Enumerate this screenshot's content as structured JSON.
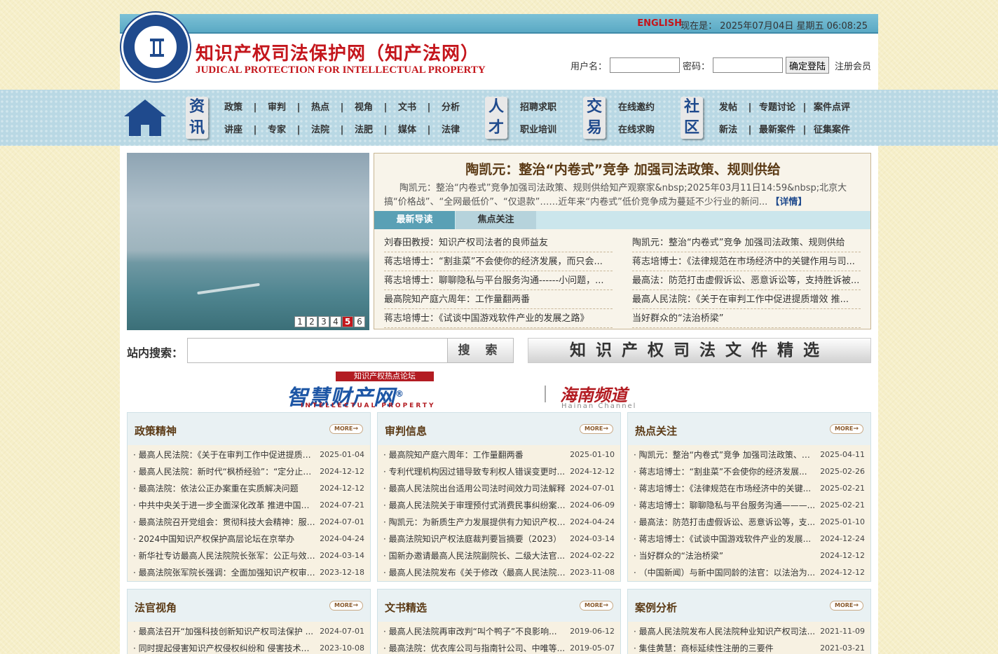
{
  "topbar": {
    "english": "ENGLISH",
    "now_label": "现在是：",
    "now_value": "2025年07月04日 星期五 06:08:25"
  },
  "header": {
    "title": "知识产权司法保护网（知产法网）",
    "subtitle": "JUDICAL PROTECTION FOR INTELLECTUAL PROPERTY",
    "logo_icon": "court-scale-logo-icon"
  },
  "login": {
    "username_label": "用户名：",
    "password_label": "密码：",
    "submit": "确定登陆",
    "register": "注册会员"
  },
  "nav": {
    "groups": [
      {
        "cat": [
          "资",
          "讯"
        ],
        "rows": [
          [
            "政策",
            "审判",
            "热点",
            "视角",
            "文书",
            "分析"
          ],
          [
            "讲座",
            "专家",
            "法院",
            "法肥",
            "媒体",
            "法律"
          ]
        ]
      },
      {
        "cat": [
          "人",
          "才"
        ],
        "rows": [
          [
            "招聘求职"
          ],
          [
            "职业培训"
          ]
        ]
      },
      {
        "cat": [
          "交",
          "易"
        ],
        "rows": [
          [
            "在线邀约"
          ],
          [
            "在线求购"
          ]
        ]
      },
      {
        "cat": [
          "社",
          "区"
        ],
        "rows": [
          [
            "发帖",
            "专题讨论",
            "案件点评"
          ],
          [
            "新法",
            "最新案件",
            "征集案件"
          ]
        ]
      }
    ]
  },
  "slider": {
    "pages": [
      "1",
      "2",
      "3",
      "4",
      "5",
      "6"
    ],
    "active": "5"
  },
  "headline": {
    "title": "陶凯元：整治“内卷式”竞争 加强司法政策、规则供给",
    "summary": "陶凯元：整治“内卷式”竞争加强司法政策、规则供给知产观察家&nbsp;2025年03月11日14:59&nbsp;北京大搞“价格战”、“全网最低价”、“仅退款”……近年来“内卷式”低价竞争成为蔓延不少行业的新问...",
    "more": "【详情】",
    "tabs": [
      "最新导读",
      "焦点关注"
    ],
    "left": [
      "刘春田教授：知识产权司法者的良师益友",
      "蒋志培博士：“割韭菜”不会使你的经济发展，而只会...",
      "蒋志培博士：聊聊隐私与平台服务沟通------小问题，...",
      "最高院知产庭六周年：工作量翻两番",
      "蒋志培博士：《试谈中国游戏软件产业的发展之路》"
    ],
    "right": [
      "陶凯元：整治“内卷式”竞争 加强司法政策、规则供给",
      "蒋志培博士：《法律规范在市场经济中的关键作用与司...",
      "最高法：防范打击虚假诉讼、恶意诉讼等，支持胜诉被...",
      "最高人民法院：《关于在审判工作中促进提质增效 推...",
      "当好群众的“法治桥梁”"
    ]
  },
  "search": {
    "label": "站内搜索：",
    "button": "搜  索",
    "placeholder": ""
  },
  "docs_banner": "知识产权司法文件精选",
  "ad": {
    "tag": "知识产权热点论坛",
    "name": "智慧财产网",
    "mark": "®",
    "english": "INTELLECTUAL PROPERTY",
    "channel": "海南频道",
    "channel_en": "Hainan Channel"
  },
  "more_label": "MORE",
  "panels": [
    {
      "title": "政策精神",
      "items": [
        [
          "最高人民法院：《关于在审判工作中促进提质增效...",
          "2025-01-04"
        ],
        [
          "最高人民法院：新时代“枫桥经验”：“定分止争...",
          "2024-12-12"
        ],
        [
          "最高法院：依法公正办案重在实质解决问题",
          "2024-12-12"
        ],
        [
          "中共中央关于进一步全面深化改革 推进中国式现代化...",
          "2024-07-21"
        ],
        [
          "最高法院召开党组会：贯彻科技大会精神：服务高...",
          "2024-07-01"
        ],
        [
          "2024中国知识产权保护高层论坛在京举办",
          "2024-04-24"
        ],
        [
          "新华社专访最高人民法院院长张军：公正与效率...",
          "2024-03-14"
        ],
        [
          "最高法院张军院长强调：全面加强知识产权审判...",
          "2023-12-18"
        ]
      ]
    },
    {
      "title": "审判信息",
      "items": [
        [
          "最高院知产庭六周年：工作量翻两番",
          "2025-01-10"
        ],
        [
          "专利代理机构因过错导致专利权人错误变更时...",
          "2024-12-12"
        ],
        [
          "最高人民法院出台适用公司法时间效力司法解释",
          "2024-07-01"
        ],
        [
          "最高人民法院关于审理预付式消费民事纠纷案件...",
          "2024-06-09"
        ],
        [
          "陶凯元：为新质生产力发展提供有力知识产权司...",
          "2024-04-24"
        ],
        [
          "最高法院知识产权法庭裁判要旨摘要（2023）",
          "2024-03-14"
        ],
        [
          "国新办邀请最高人民法院副院长、二级大法官...",
          "2024-02-22"
        ],
        [
          "最高人民法院发布《关于修改〈最高人民法院关...",
          "2023-11-08"
        ]
      ]
    },
    {
      "title": "热点关注",
      "items": [
        [
          "陶凯元：整治“内卷式”竞争 加强司法政策、规则供给",
          "2025-04-11"
        ],
        [
          "蒋志培博士：“割韭菜”不会使你的经济发展...",
          "2025-02-26"
        ],
        [
          "蒋志培博士：《法律规范在市场经济中的关键...",
          "2025-02-21"
        ],
        [
          "蒋志培博士：聊聊隐私与平台服务沟通———...",
          "2025-02-21"
        ],
        [
          "最高法：防范打击虚假诉讼、恶意诉讼等，支...",
          "2025-01-10"
        ],
        [
          "蒋志培博士：《试谈中国游戏软件产业的发展...",
          "2024-12-24"
        ],
        [
          "当好群众的“法治桥梁”",
          "2024-12-12"
        ],
        [
          "（中国新闻）与新中国同龄的法官：以法治为...",
          "2024-12-12"
        ]
      ]
    },
    {
      "title": "法官视角",
      "items": [
        [
          "最高法召开“加强科技创新知识产权司法保护 ...",
          "2024-07-01"
        ],
        [
          "同时提起侵害知识产权侵权纠纷和 侵害技术秘...",
          "2023-10-08"
        ]
      ]
    },
    {
      "title": "文书精选",
      "items": [
        [
          "最高人民法院再审改判“叫个鸭子”不良影响...",
          "2019-06-12"
        ],
        [
          "最高法院：优衣库公司与指南针公司、中唯等...",
          "2019-05-07"
        ]
      ]
    },
    {
      "title": "案例分析",
      "items": [
        [
          "最高人民法院发布人民法院种业知识产权司法...",
          "2021-11-09"
        ],
        [
          "集佳黄慧：商标延续性注册的三要件",
          "2021-03-21"
        ]
      ]
    }
  ]
}
